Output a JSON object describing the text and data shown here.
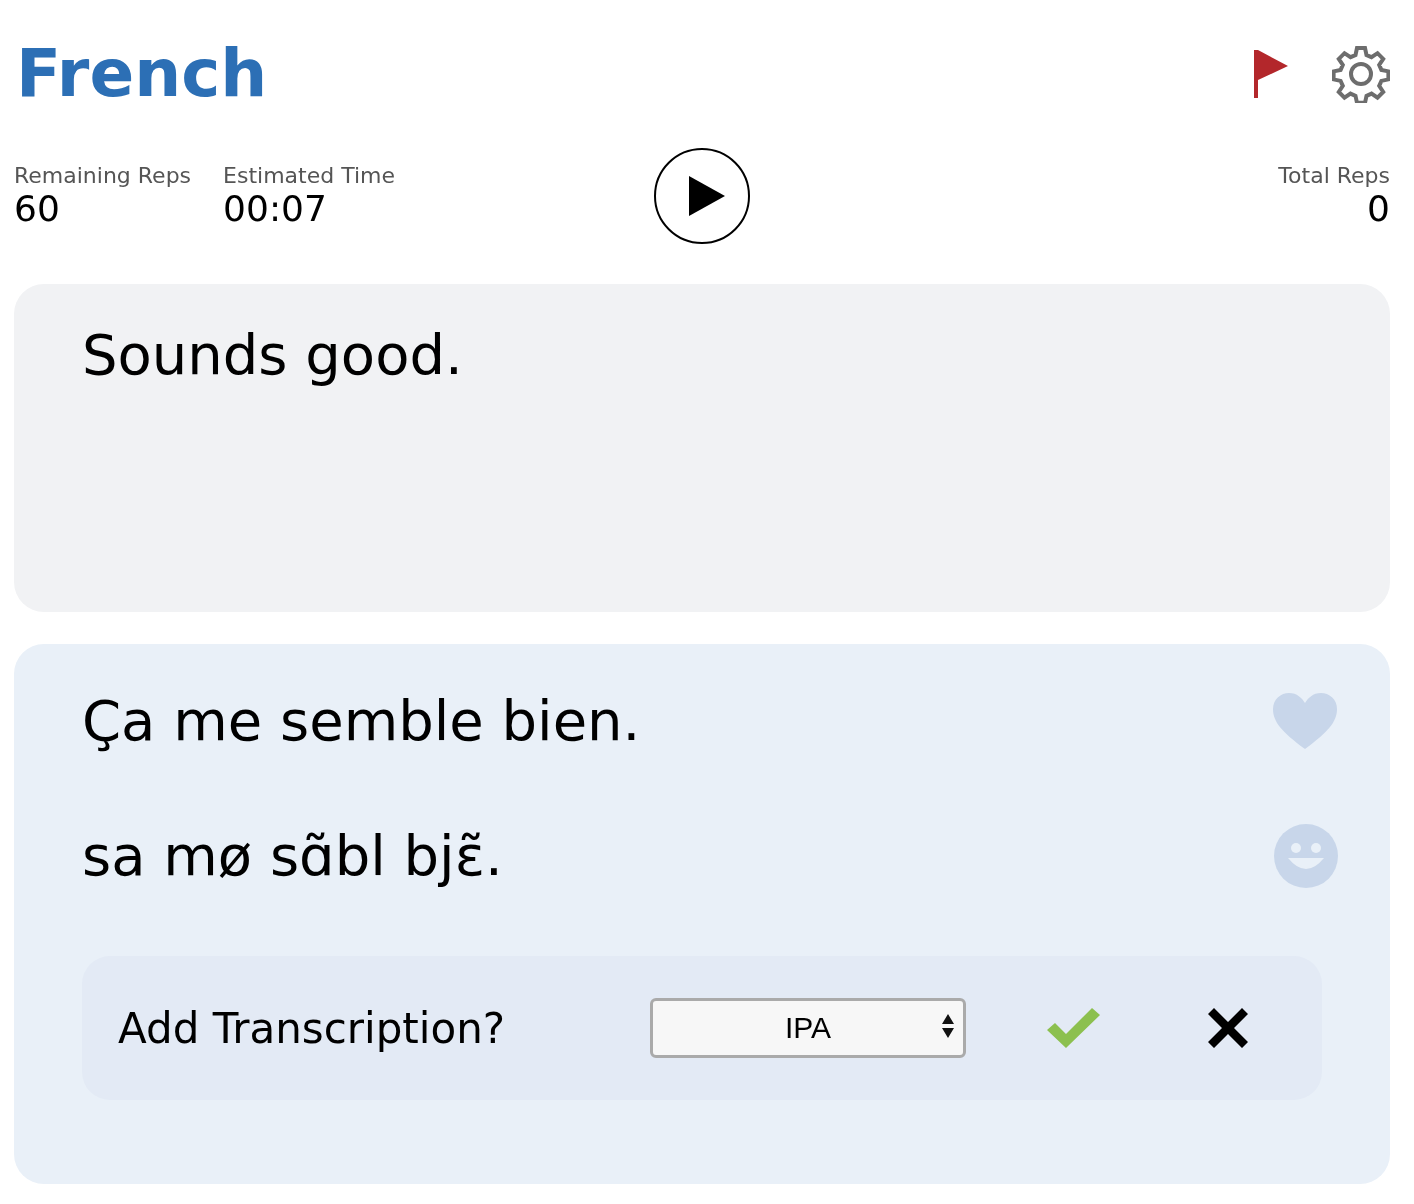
{
  "title": "French",
  "stats_left": [
    {
      "label": "Remaining Reps",
      "value": "60"
    },
    {
      "label": "Estimated Time",
      "value": "00:07"
    }
  ],
  "stats_right": [
    {
      "label": "Total Reps",
      "value": "0"
    }
  ],
  "prompt": {
    "text": "Sounds good."
  },
  "answer": {
    "text": "Ça me semble bien.",
    "transcription": "sa mø sɑ̃bl bjɛ̃."
  },
  "transcription_panel": {
    "label": "Add Transcription?",
    "select": {
      "value": "IPA"
    }
  }
}
